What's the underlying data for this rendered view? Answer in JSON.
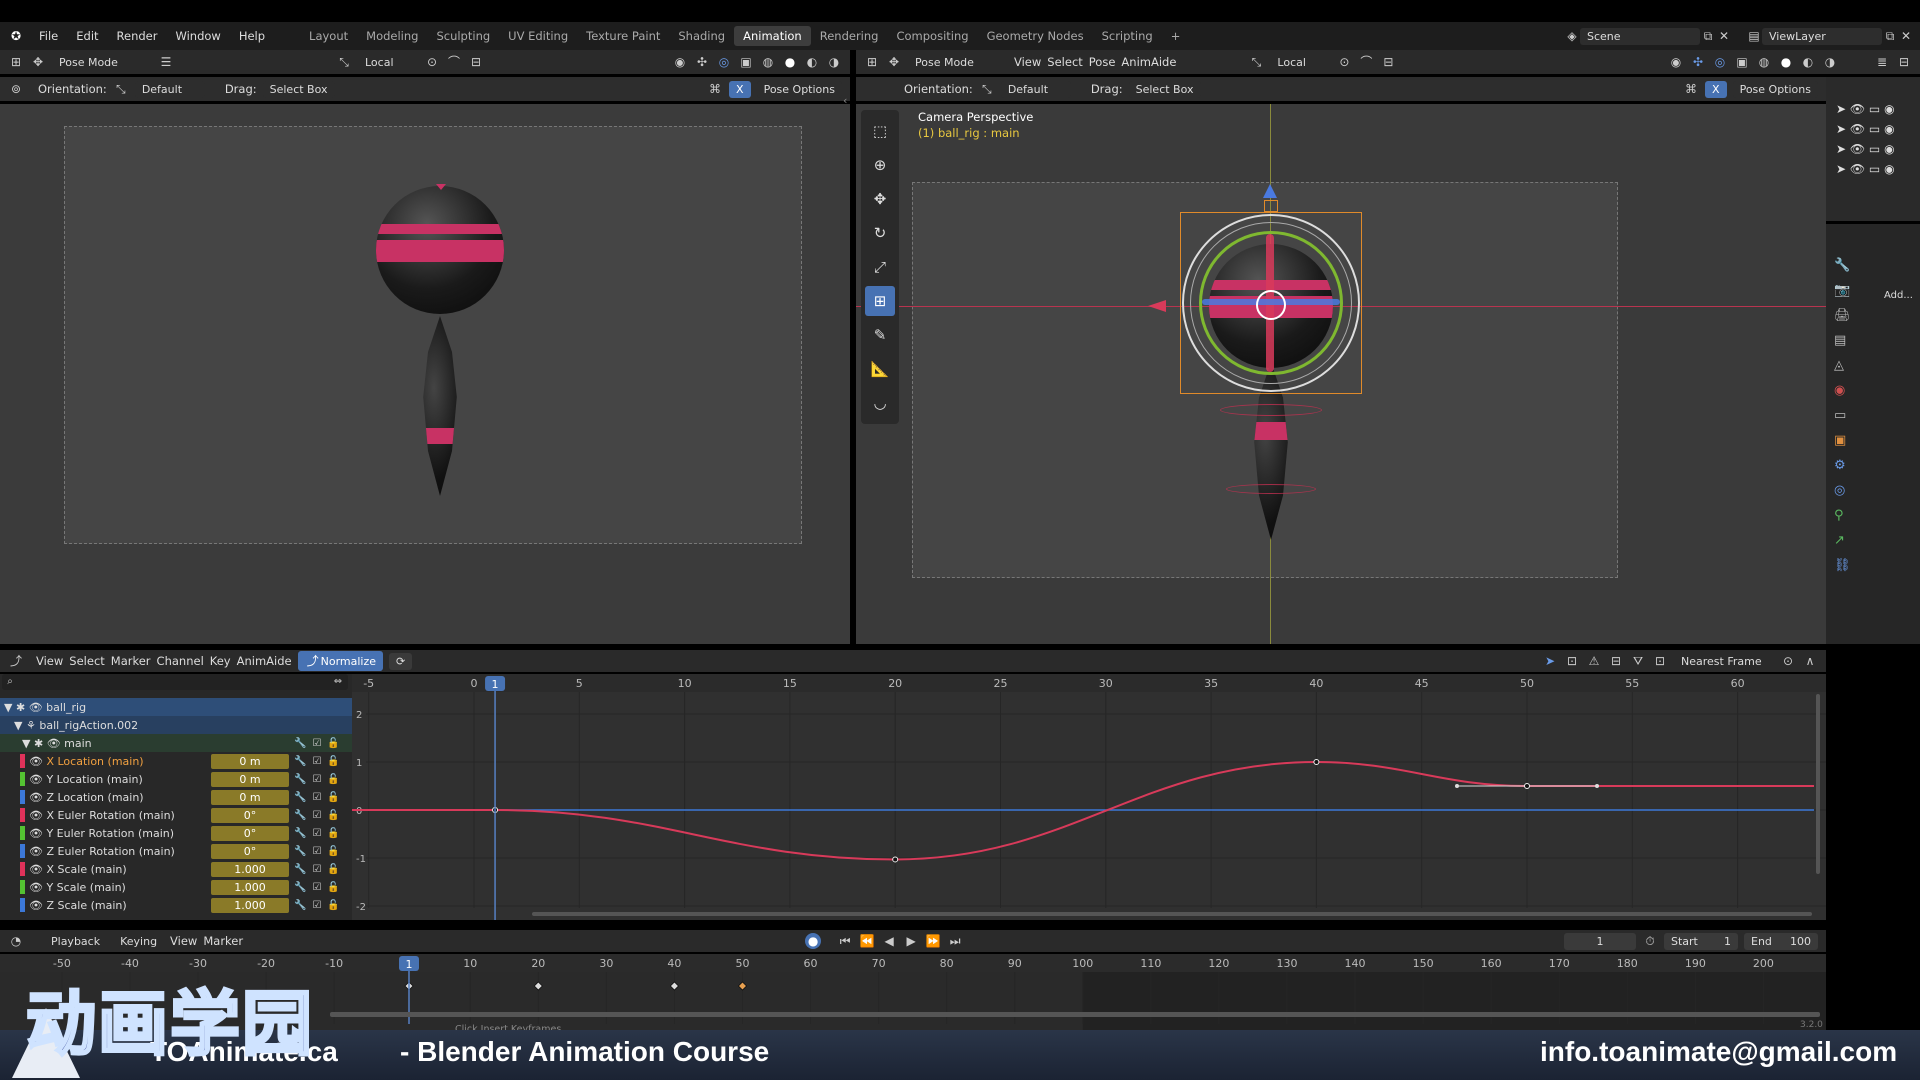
{
  "menu": {
    "items": [
      "File",
      "Edit",
      "Render",
      "Window",
      "Help"
    ],
    "workspaces": [
      "Layout",
      "Modeling",
      "Sculpting",
      "UV Editing",
      "Texture Paint",
      "Shading",
      "Animation",
      "Rendering",
      "Compositing",
      "Geometry Nodes",
      "Scripting"
    ],
    "active_workspace": "Animation",
    "scene": "Scene",
    "view_layer": "ViewLayer"
  },
  "left_view": {
    "mode": "Pose Mode",
    "transform": "Local",
    "orientation_label": "Orientation:",
    "orientation": "Default",
    "drag_label": "Drag:",
    "drag": "Select Box",
    "pose_options": "Pose Options"
  },
  "right_view": {
    "mode": "Pose Mode",
    "menus": [
      "View",
      "Select",
      "Pose",
      "AnimAide"
    ],
    "transform": "Local",
    "orientation_label": "Orientation:",
    "orientation": "Default",
    "drag_label": "Drag:",
    "drag": "Select Box",
    "pose_options": "Pose Options",
    "overlay_title": "Camera Perspective",
    "overlay_sub": "(1) ball_rig : main",
    "add_label": "Add..."
  },
  "graph": {
    "menus": [
      "View",
      "Select",
      "Marker",
      "Channel",
      "Key",
      "AnimAide"
    ],
    "normalize": "Normalize",
    "snap": "Nearest Frame",
    "current_frame": "1",
    "frame_ticks": [
      "-5",
      "0",
      "5",
      "10",
      "15",
      "20",
      "25",
      "30",
      "35",
      "40",
      "45",
      "50",
      "55",
      "60"
    ],
    "value_ticks": [
      "2",
      "1",
      "0",
      "-1",
      "-2"
    ],
    "channels": [
      {
        "name": "ball_rig",
        "value": "",
        "color": "",
        "kind": "object"
      },
      {
        "name": "ball_rigAction.002",
        "value": "",
        "color": "",
        "kind": "action"
      },
      {
        "name": "main",
        "value": "",
        "color": "",
        "kind": "group"
      },
      {
        "name": "X Location (main)",
        "value": "0 m",
        "color": "#e0325a",
        "kind": "fcurve",
        "selected": true
      },
      {
        "name": "Y Location (main)",
        "value": "0 m",
        "color": "#54c232",
        "kind": "fcurve"
      },
      {
        "name": "Z Location (main)",
        "value": "0 m",
        "color": "#3c78d8",
        "kind": "fcurve"
      },
      {
        "name": "X Euler Rotation (main)",
        "value": "0°",
        "color": "#e0325a",
        "kind": "fcurve"
      },
      {
        "name": "Y Euler Rotation (main)",
        "value": "0°",
        "color": "#54c232",
        "kind": "fcurve"
      },
      {
        "name": "Z Euler Rotation (main)",
        "value": "0°",
        "color": "#3c78d8",
        "kind": "fcurve"
      },
      {
        "name": "X Scale (main)",
        "value": "1.000",
        "color": "#e0325a",
        "kind": "fcurve"
      },
      {
        "name": "Y Scale (main)",
        "value": "1.000",
        "color": "#54c232",
        "kind": "fcurve"
      },
      {
        "name": "Z Scale (main)",
        "value": "1.000",
        "color": "#3c78d8",
        "kind": "fcurve"
      }
    ],
    "curve_keys": [
      [
        1,
        0
      ],
      [
        20,
        -1.03
      ],
      [
        40,
        1.0
      ],
      [
        50,
        0.5
      ]
    ]
  },
  "timeline": {
    "menus": [
      "Playback",
      "Keying",
      "View",
      "Marker"
    ],
    "frame_ticks": [
      "-50",
      "-40",
      "-30",
      "-20",
      "-10",
      "1",
      "10",
      "20",
      "30",
      "40",
      "50",
      "60",
      "70",
      "80",
      "90",
      "100",
      "110",
      "120",
      "130",
      "140",
      "150",
      "160",
      "170",
      "180",
      "190",
      "200"
    ],
    "current_frame": "1",
    "start_label": "Start",
    "start": "1",
    "end_label": "End",
    "end": "100",
    "keyframes": [
      1,
      20,
      40,
      50
    ],
    "status_hint": "Click Insert Keyframes",
    "version": "3.2.0"
  },
  "footer": {
    "logo": "动画学园",
    "site": "TOAnimate.ca",
    "course": "- Blender Animation Course",
    "email": "info.toanimate@gmail.com"
  },
  "colors": {
    "accent": "#4772b3",
    "x_axis": "#e0325a",
    "y_axis": "#54c232",
    "z_axis": "#3c78d8",
    "selection": "#e08a2a"
  }
}
